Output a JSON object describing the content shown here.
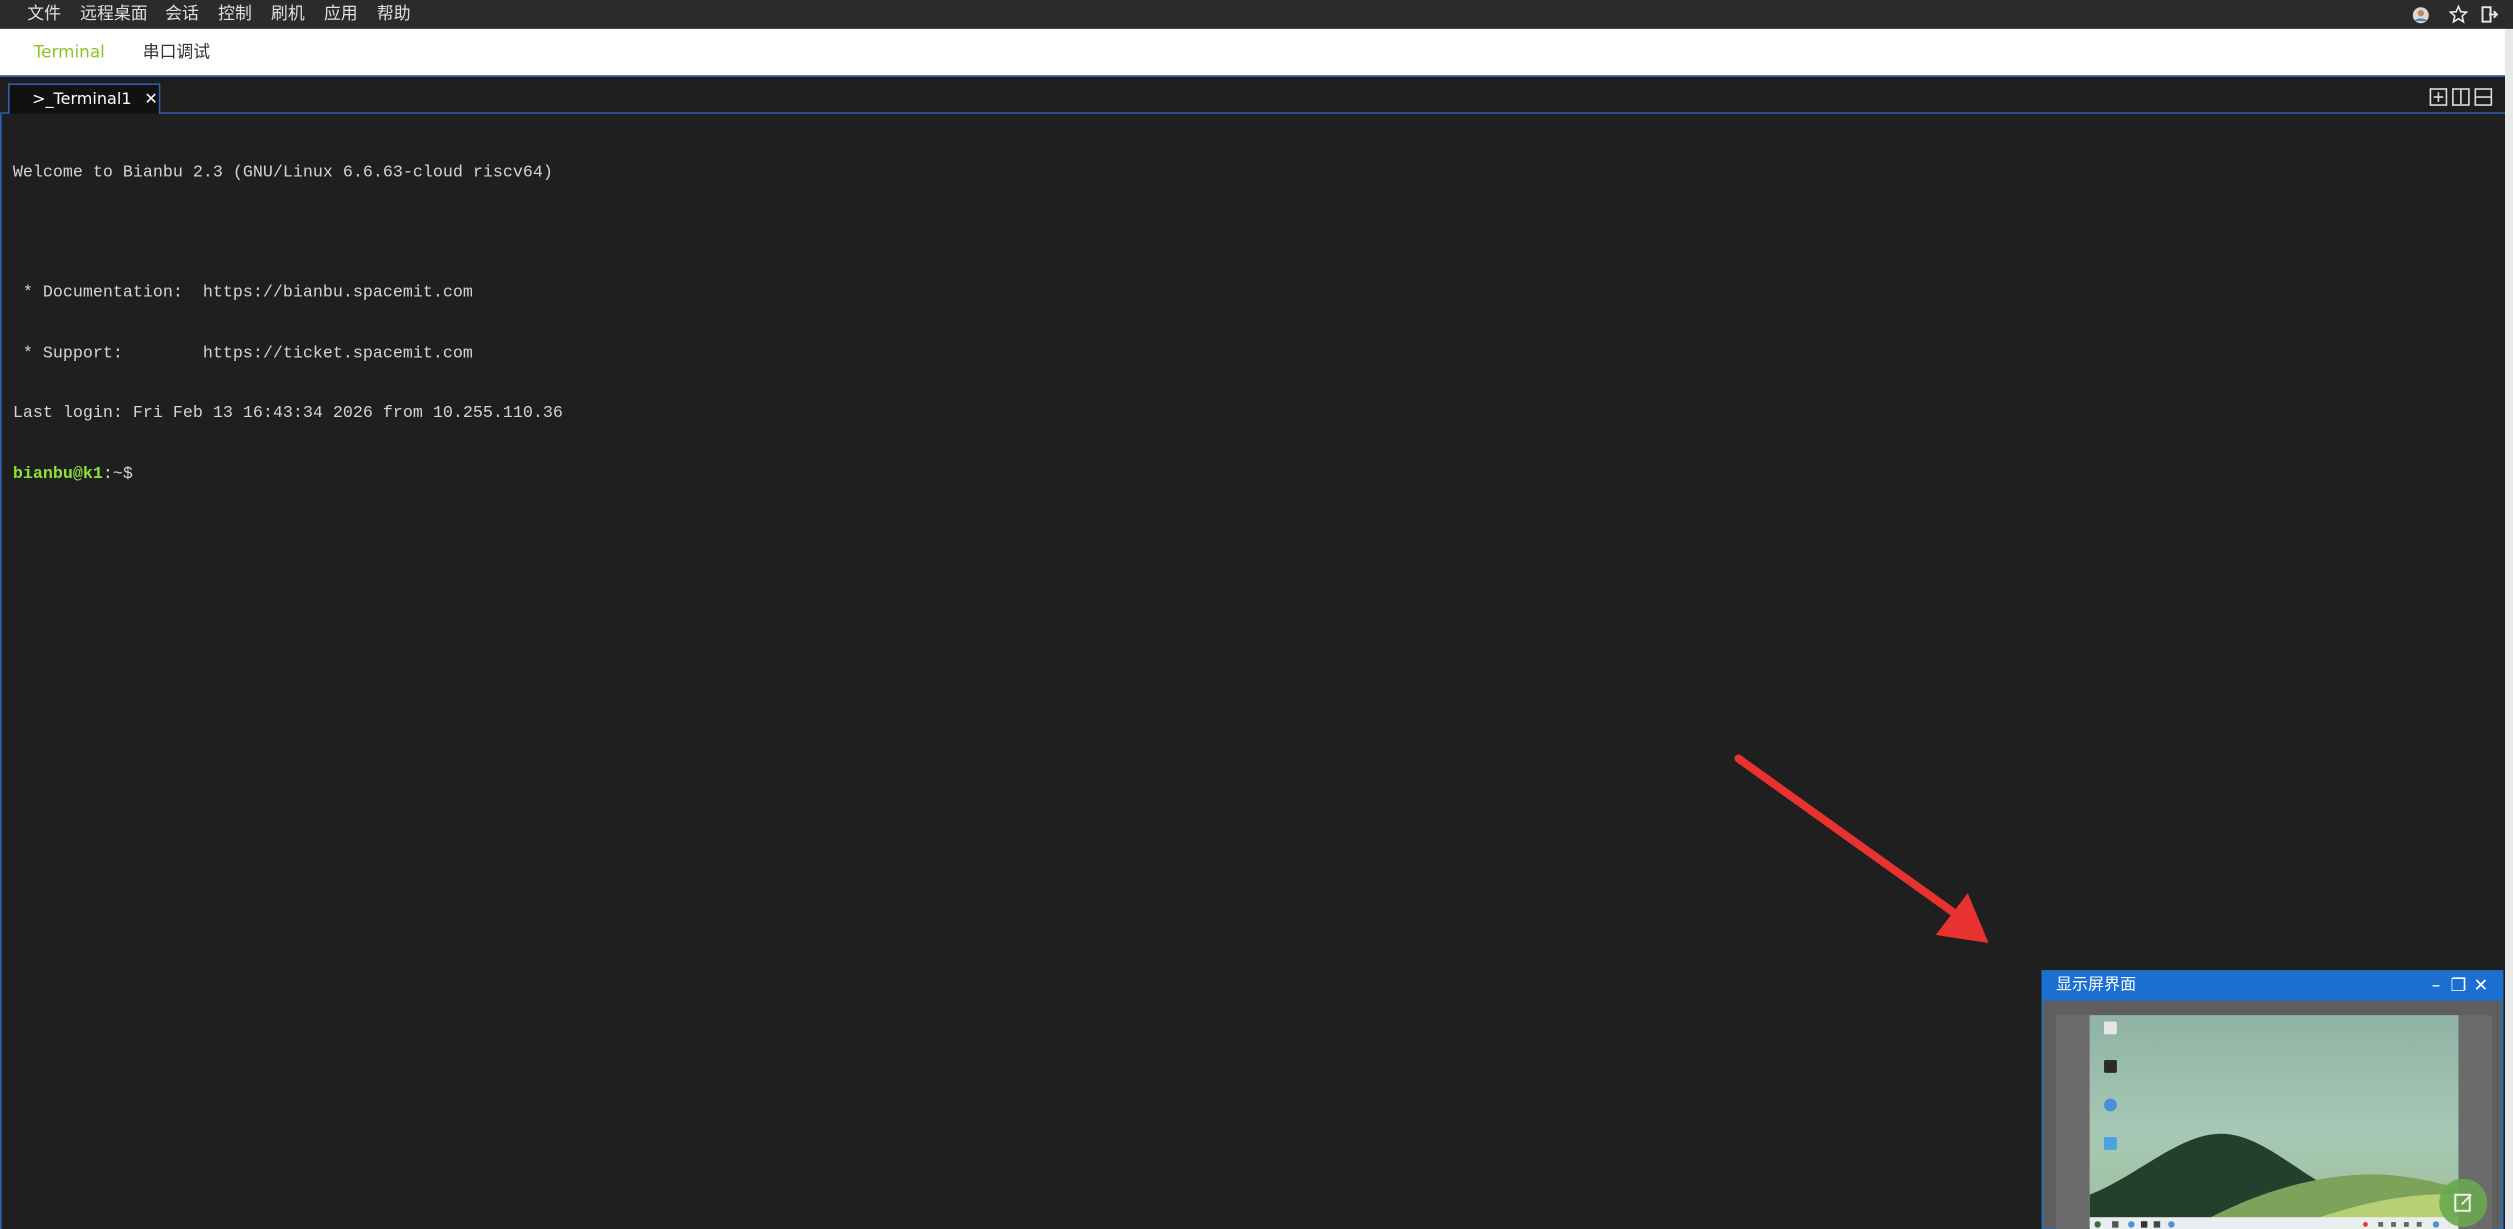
{
  "menu": {
    "items": [
      {
        "label": "文件"
      },
      {
        "label": "远程桌面"
      },
      {
        "label": "会话"
      },
      {
        "label": "控制"
      },
      {
        "label": "刷机"
      },
      {
        "label": "应用"
      },
      {
        "label": "帮助"
      }
    ]
  },
  "header_icons": [
    "avatar",
    "star-icon",
    "logout-icon"
  ],
  "app_tabs": [
    {
      "label": "Terminal",
      "active": true
    },
    {
      "label": "串口调试",
      "active": false
    }
  ],
  "terminal_tab": {
    "prefix": ">_",
    "label": "Terminal1",
    "close": "✕"
  },
  "terminal": {
    "lines": [
      "Welcome to Bianbu 2.3 (GNU/Linux 6.6.63-cloud riscv64)",
      "",
      " * Documentation:  https://bianbu.spacemit.com",
      " * Support:        https://ticket.spacemit.com",
      "Last login: Fri Feb 13 16:43:34 2026 from 10.255.110.36"
    ],
    "prompt_user": "bianbu@k1",
    "prompt_path": ":~$"
  },
  "display_window": {
    "title": "显示屏界面",
    "minimize": "–",
    "restore": "❐",
    "close": "✕"
  },
  "colors": {
    "accent": "#8fc320",
    "prompt": "#8ae234",
    "window_title": "#1a6fd1",
    "arrow": "#e8322f"
  }
}
